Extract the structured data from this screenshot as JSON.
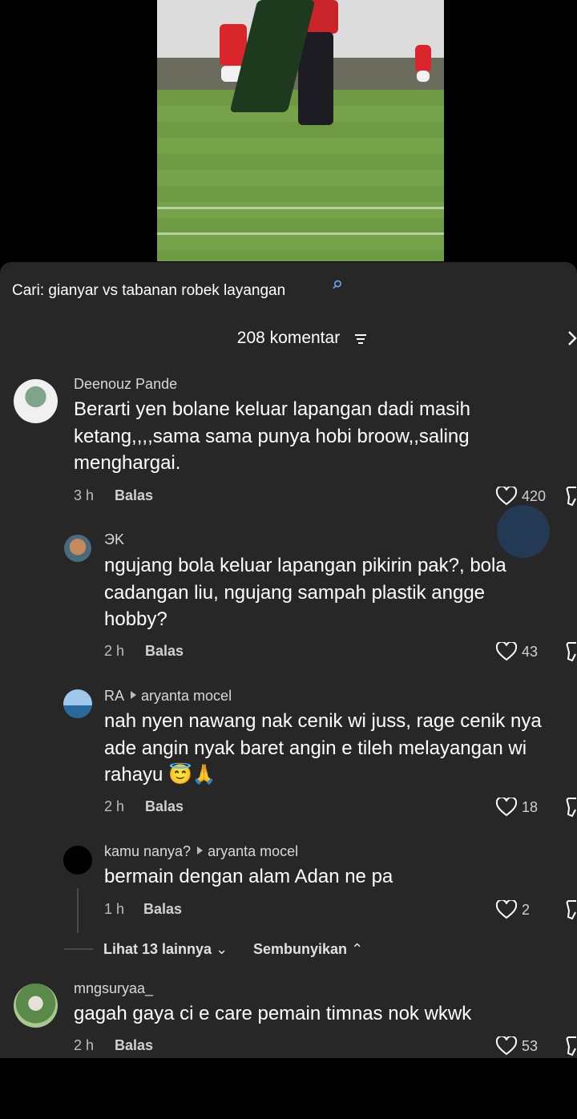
{
  "search": {
    "prefix": "Cari: ",
    "query": "gianyar vs tabanan robek layangan"
  },
  "header": {
    "count_label": "208 komentar"
  },
  "comments": [
    {
      "user": "Deenouz Pande",
      "text": "Berarti yen bolane keluar lapangan dadi masih\nketang,,,,sama sama punya hobi broow,,saling\nmenghargai.",
      "time": "3 h",
      "reply": "Balas",
      "likes": "420"
    },
    {
      "user": "ЭK",
      "text": "ngujang bola keluar lapangan pikirin pak?, bola\ncadangan liu, ngujang sampah plastik angge\nhobby?",
      "time": "2 h",
      "reply": "Balas",
      "likes": "43"
    },
    {
      "user": "RA",
      "reply_to": "aryanta mocel",
      "text": "nah nyen nawang nak cenik wi juss, rage cenik nya\nade angin nyak baret angin e tileh melayangan wi\nrahayu 😇🙏",
      "time": "2 h",
      "reply": "Balas",
      "likes": "18"
    },
    {
      "user": "kamu nanya?",
      "reply_to": "aryanta mocel",
      "text": "bermain dengan alam Adan ne pa",
      "time": "1 h",
      "reply": "Balas",
      "likes": "2"
    },
    {
      "user": "mngsuryaa_",
      "text": "gagah gaya ci e care pemain timnas nok wkwk",
      "time": "2 h",
      "reply": "Balas",
      "likes": "53"
    }
  ],
  "thread": {
    "more_label": "Lihat 13 lainnya",
    "hide_label": "Sembunyikan"
  }
}
